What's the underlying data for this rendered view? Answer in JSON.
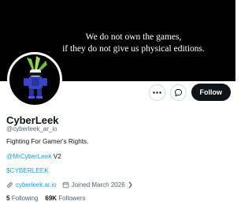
{
  "banner": {
    "line1": "We do not own the games,",
    "line2": "if they do not give us physical editions."
  },
  "actions": {
    "follow_label": "Follow",
    "more_icon": "more-dots-icon",
    "message_icon": "message-icon"
  },
  "profile": {
    "display_name": "CyberLeek",
    "handle": "@cyberleek_ar_io",
    "bio": "Fighting For Gamer's Rights.",
    "mention": "@MrCyberLeek",
    "mention_suffix": " V2",
    "cashtag": "$CYBERLEEK",
    "website": "cyberleek.ar.io",
    "joined": "Joined March 2026",
    "following_count": "5",
    "following_label": "Following",
    "followers_count": "69K",
    "followers_label": "Followers"
  },
  "colors": {
    "link": "#1d9bf0",
    "muted": "#536471",
    "banner": "#000000"
  }
}
